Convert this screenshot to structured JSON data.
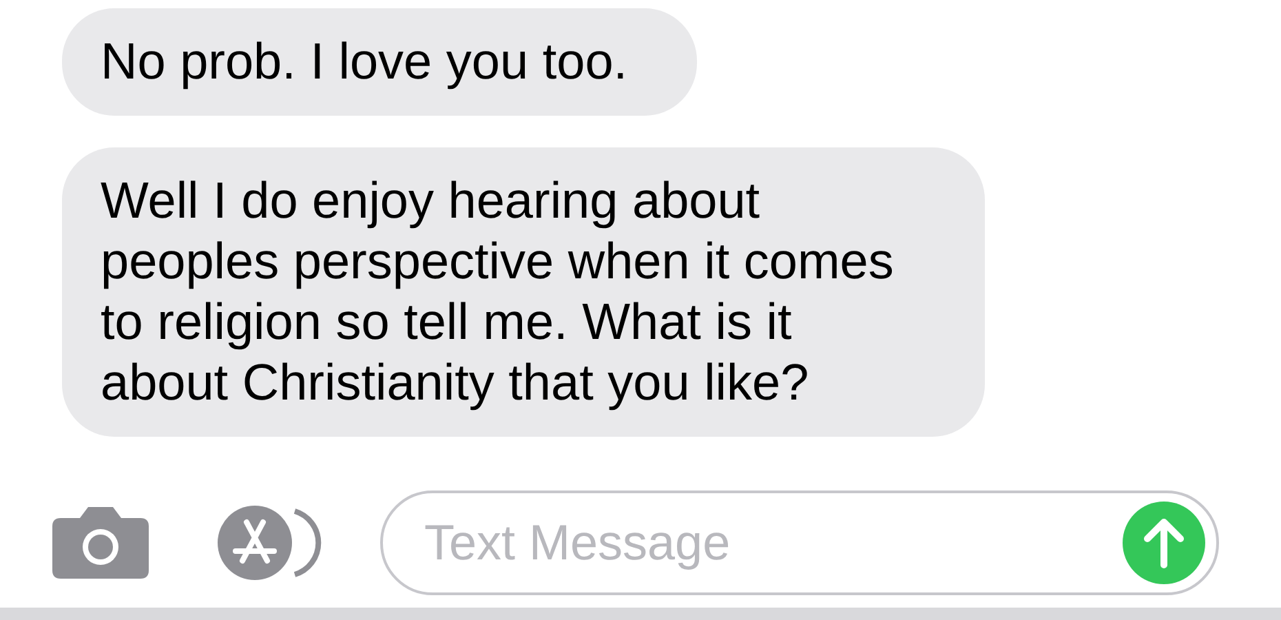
{
  "messages": [
    {
      "text": "No prob. I love you too."
    },
    {
      "text": "Well I do enjoy hearing about peoples perspective when it comes to religion so tell me. What is it about Christianity that you like?"
    }
  ],
  "composer": {
    "placeholder": "Text Message"
  }
}
